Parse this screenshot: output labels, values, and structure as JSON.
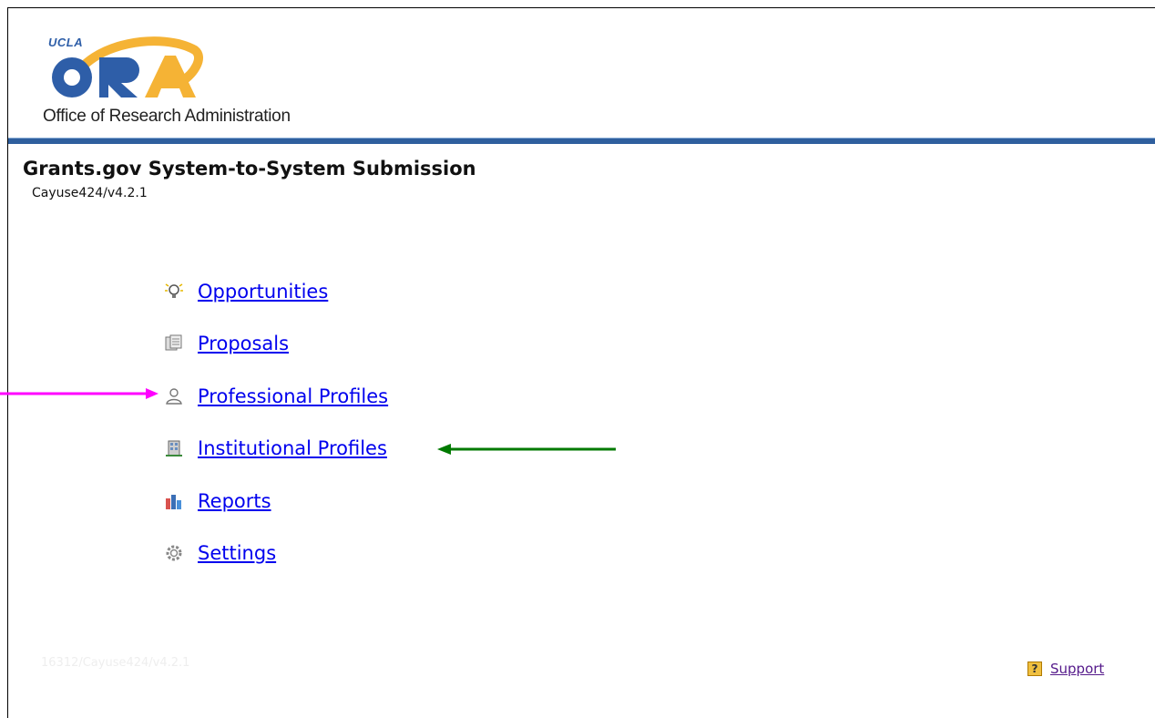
{
  "header": {
    "logo_ucla": "UCLA",
    "logo_mark": "ORA",
    "logo_subtitle": "Office of Research Administration"
  },
  "page": {
    "title": "Grants.gov System-to-System Submission",
    "version": "Cayuse424/v4.2.1"
  },
  "menu": {
    "items": [
      {
        "label": "Opportunities",
        "icon": "lightbulb-icon"
      },
      {
        "label": "Proposals",
        "icon": "proposals-icon"
      },
      {
        "label": "Professional Profiles",
        "icon": "person-icon"
      },
      {
        "label": "Institutional Profiles",
        "icon": "building-icon"
      },
      {
        "label": "Reports",
        "icon": "bar-chart-icon"
      },
      {
        "label": "Settings",
        "icon": "gear-icon"
      }
    ]
  },
  "footer": {
    "build_id": "16312/Cayuse424/v4.2.1",
    "support_label": "Support",
    "support_icon": "help-icon",
    "help_glyph": "?"
  },
  "annotations": {
    "pink_arrow_color": "#ff00ff",
    "green_arrow_color": "#007a00"
  }
}
